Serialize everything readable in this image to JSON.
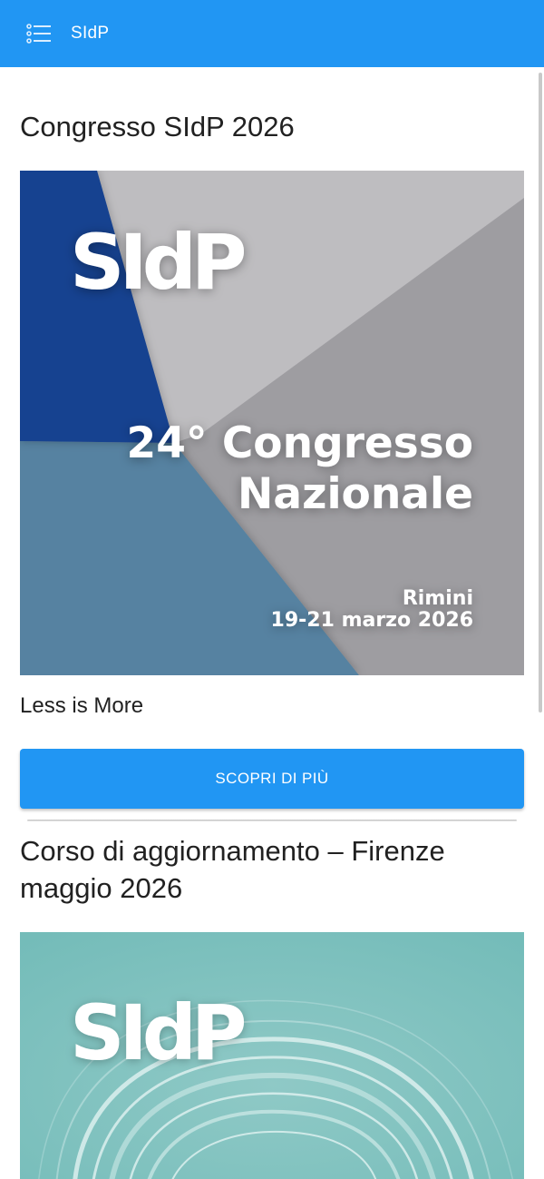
{
  "app_bar": {
    "title": "SIdP",
    "menu_icon": "list-menu-icon",
    "color": "#2196f3"
  },
  "posts": [
    {
      "title": "Congresso SIdP 2026",
      "banner": {
        "logo": "SIdP",
        "headline_line1": "24° Congresso",
        "headline_line2": "Nazionale",
        "location": "Rimini",
        "dates": "19-21 marzo 2026"
      },
      "subtitle": "Less is More",
      "button_label": "SCOPRI DI PIÙ"
    },
    {
      "title": "Corso di aggiornamento – Firenze maggio 2026",
      "banner": {
        "logo": "SIdP"
      }
    }
  ]
}
